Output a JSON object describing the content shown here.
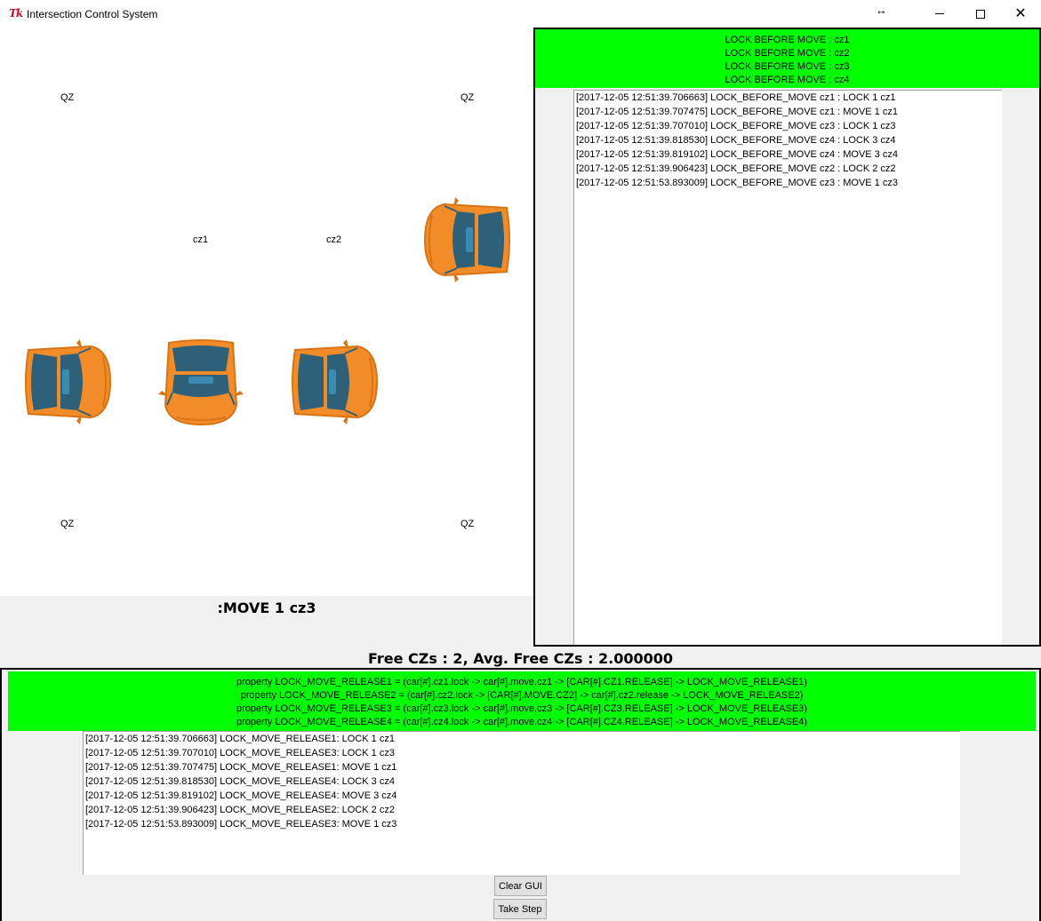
{
  "window": {
    "title": "Intersection Control System",
    "icon_text": "Tk"
  },
  "canvas": {
    "zone_labels": {
      "qz_top_left": "QZ",
      "qz_top_right": "QZ",
      "qz_bottom_left": "QZ",
      "qz_bottom_right": "QZ",
      "cz1": "cz1",
      "cz2": "cz2"
    },
    "cars": [
      {
        "name": "car-top-right",
        "orientation": "left"
      },
      {
        "name": "car-left",
        "orientation": "right"
      },
      {
        "name": "car-center",
        "orientation": "down"
      },
      {
        "name": "car-right",
        "orientation": "right"
      }
    ]
  },
  "current_action": ":MOVE 1 cz3",
  "free_czs": "Free CZs : 2, Avg. Free CZs : 2.000000",
  "right_panel": {
    "header_lines": [
      "LOCK BEFORE MOVE : cz1",
      "LOCK BEFORE MOVE : cz2",
      "LOCK BEFORE MOVE : cz3",
      "LOCK BEFORE MOVE : cz4"
    ],
    "log": [
      "[2017-12-05 12:51:39.706663] LOCK_BEFORE_MOVE cz1 : LOCK 1 cz1",
      "[2017-12-05 12:51:39.707475] LOCK_BEFORE_MOVE cz1 : MOVE 1 cz1",
      "[2017-12-05 12:51:39.707010] LOCK_BEFORE_MOVE cz3 : LOCK 1 cz3",
      "[2017-12-05 12:51:39.818530] LOCK_BEFORE_MOVE cz4 : LOCK 3 cz4",
      "[2017-12-05 12:51:39.819102] LOCK_BEFORE_MOVE cz4 : MOVE 3 cz4",
      "[2017-12-05 12:51:39.906423] LOCK_BEFORE_MOVE cz2 : LOCK 2 cz2",
      "[2017-12-05 12:51:53.893009] LOCK_BEFORE_MOVE cz3 : MOVE 1 cz3"
    ]
  },
  "bottom_panel": {
    "header_lines": [
      "property LOCK_MOVE_RELEASE1 = (car[#].cz1.lock -> car[#].move.cz1 -> [CAR[#].CZ1.RELEASE] -> LOCK_MOVE_RELEASE1)",
      "property LOCK_MOVE_RELEASE2 = (car[#].cz2.lock -> [CAR[#].MOVE.CZ2] -> car[#].cz2.release -> LOCK_MOVE_RELEASE2)",
      "property LOCK_MOVE_RELEASE3 = (car[#].cz3.lock -> car[#].move.cz3 -> [CAR[#].CZ3.RELEASE] -> LOCK_MOVE_RELEASE3)",
      "property LOCK_MOVE_RELEASE4 = (car[#].cz4.lock -> car[#].move.cz4 -> [CAR[#].CZ4.RELEASE] -> LOCK_MOVE_RELEASE4)"
    ],
    "log": [
      "[2017-12-05 12:51:39.706663] LOCK_MOVE_RELEASE1: LOCK 1 cz1",
      "[2017-12-05 12:51:39.707010] LOCK_MOVE_RELEASE3: LOCK 1 cz3",
      "[2017-12-05 12:51:39.707475] LOCK_MOVE_RELEASE1: MOVE 1 cz1",
      "[2017-12-05 12:51:39.818530] LOCK_MOVE_RELEASE4: LOCK 3 cz4",
      "[2017-12-05 12:51:39.819102] LOCK_MOVE_RELEASE4: MOVE 3 cz4",
      "[2017-12-05 12:51:39.906423] LOCK_MOVE_RELEASE2: LOCK 2 cz2",
      "[2017-12-05 12:51:53.893009] LOCK_MOVE_RELEASE3: MOVE 1 cz3"
    ]
  },
  "buttons": {
    "clear": "Clear GUI",
    "step": "Take Step"
  },
  "colors": {
    "header_green": "#00ff00",
    "car_body": "#f28c28",
    "car_glass": "#2e6079"
  }
}
